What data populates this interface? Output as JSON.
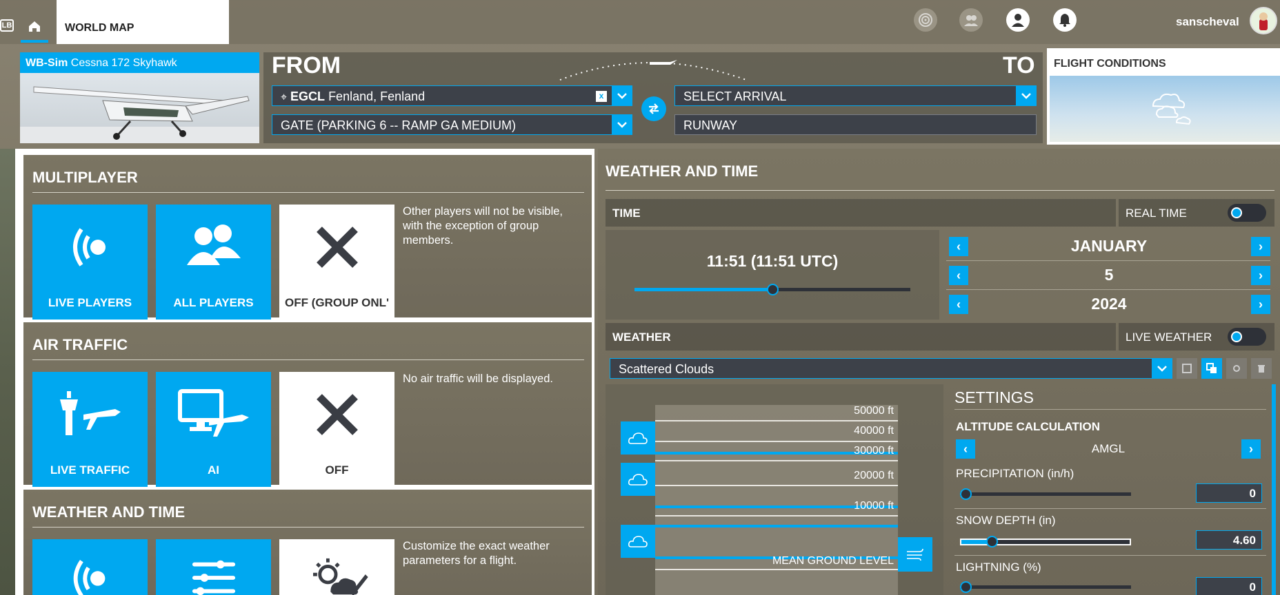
{
  "topbar": {
    "lb_label": "LB",
    "home_icon": "home-icon",
    "tab_label": "WORLD MAP",
    "username": "sanscheval",
    "icons": [
      "radar-icon",
      "group-icon",
      "profile-icon",
      "bell-icon"
    ]
  },
  "aircraft": {
    "brand": "WB-Sim",
    "model": "Cessna 172 Skyhawk"
  },
  "route": {
    "from_label": "FROM",
    "to_label": "TO",
    "departure_code": "EGCL",
    "departure_name": "Fenland, Fenland",
    "departure_clear": "x",
    "departure_spawn": "GATE (PARKING 6 -- RAMP GA MEDIUM)",
    "arrival_placeholder": "SELECT ARRIVAL",
    "arrival_spawn": "RUNWAY"
  },
  "conditions": {
    "title": "FLIGHT CONDITIONS"
  },
  "multiplayer": {
    "title": "MULTIPLAYER",
    "tiles": [
      "LIVE PLAYERS",
      "ALL PLAYERS",
      "OFF (GROUP ONL'"
    ],
    "description": "Other players will not be visible, with the exception of group members."
  },
  "air_traffic": {
    "title": "AIR TRAFFIC",
    "tiles": [
      "LIVE TRAFFIC",
      "AI",
      "OFF"
    ],
    "description": "No air traffic will be displayed."
  },
  "weather_time_left": {
    "title": "WEATHER AND TIME",
    "description": "Customize the exact weather parameters for a flight."
  },
  "weather_time": {
    "title": "WEATHER AND TIME",
    "time_label": "TIME",
    "real_time_label": "REAL TIME",
    "time_value": "11:51 (11:51 UTC)",
    "time_slider": 0.5,
    "month": "JANUARY",
    "day": "5",
    "year": "2024",
    "weather_label": "WEATHER",
    "live_weather_label": "LIVE WEATHER",
    "preset": "Scattered Clouds",
    "altitudes": [
      "50000 ft",
      "40000 ft",
      "30000 ft",
      "20000 ft",
      "10000 ft",
      "MEAN GROUND LEVEL"
    ]
  },
  "settings": {
    "title": "SETTINGS",
    "altitude_calc_label": "ALTITUDE CALCULATION",
    "altitude_calc_value": "AMGL",
    "precipitation_label": "PRECIPITATION (in/h)",
    "precipitation_value": "0",
    "precipitation_level": 0.0,
    "snow_label": "SNOW DEPTH (in)",
    "snow_value": "4.60",
    "snow_level": 0.18,
    "lightning_label": "LIGHTNING (%)",
    "lightning_value": "0",
    "lightning_level": 0.0
  },
  "colors": {
    "accent": "#00a8f0",
    "panel": "#7b7563",
    "field": "#3d4149"
  }
}
